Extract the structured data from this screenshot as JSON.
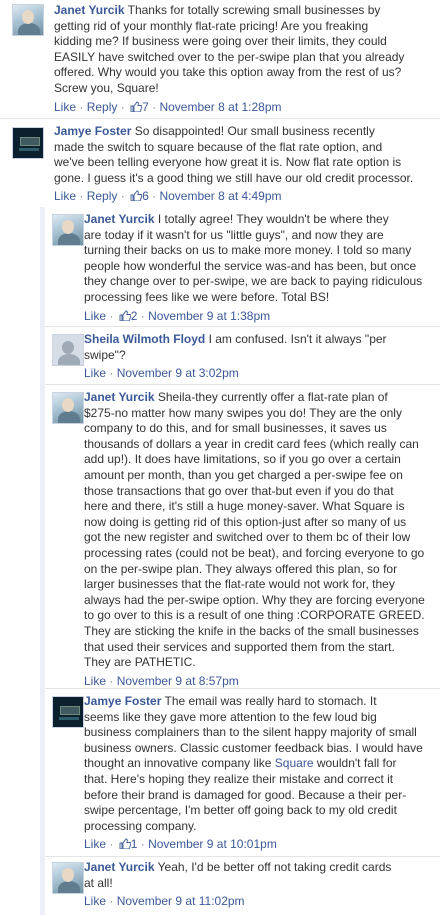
{
  "actions": {
    "like": "Like",
    "reply": "Reply",
    "separator": "·"
  },
  "comments": [
    {
      "author": "Janet Yurcik",
      "text": "Thanks for totally screwing small businesses by\ngetting rid of your monthly flat-rate pricing! Are you freaking\nkidding me? If business were going over their limits, they could\nEASILY have switched over to the per-swipe plan that you already\noffered. Why would you take this option away from the rest of us?\nScrew you, Square!",
      "likes": "7",
      "timestamp": "November 8 at 1:28pm"
    },
    {
      "author": "Jamye Foster",
      "text": "So disappointed! Our small business recently\nmade the switch to square because of the flat rate option, and\nwe've been telling everyone how great it is. Now flat rate option is\ngone. I guess it's a good thing we still have our old credit processor.",
      "likes": "6",
      "timestamp": "November 8 at 4:49pm"
    },
    {
      "author": "Janet Yurcik",
      "text": "I totally agree! They wouldn't be where they\nare today if it wasn't for us \"little guys\", and now they are\nturning their backs on us to make more money. I told so many\npeople how wonderful the service was-and has been, but once\nthey change over to per-swipe, we are back to paying ridiculous\nprocessing fees like we were before. Total BS!",
      "likes": "2",
      "timestamp": "November 9 at 1:38pm"
    },
    {
      "author": "Sheila Wilmoth Floyd",
      "text": "I am confused. Isn't it always \"per\nswipe\"?",
      "timestamp": "November 9 at 3:02pm"
    },
    {
      "author": "Janet Yurcik",
      "text": "Sheila-they currently offer a flat-rate plan of\n$275-no matter how many swipes you do! They are the only\ncompany to do this, and for small businesses, it saves us\nthousands of dollars a year in credit card fees (which really can\nadd up!). It does have limitations, so if you go over a certain\namount per month, than you get charged a per-swipe fee on\nthose transactions that go over that-but even if you do that\nhere and there, it's still a huge money-saver. What Square is\nnow doing is getting rid of this option-just after so many of us\ngot the new register and switched over to them bc of their low\nprocessing rates (could not be beat), and forcing everyone to go\non the per-swipe plan. They always offered this plan, so for\nlarger businesses that the flat-rate would not work for, they\nalways had the per-swipe option. Why they are forcing everyone\nto go over to this is a result of one thing :CORPORATE GREED.\nThey are sticking the knife in the backs of the small businesses\nthat used their services and supported them from the start.\nThey are PATHETIC.",
      "timestamp": "November 9 at 8:57pm"
    },
    {
      "author": "Jamye Foster",
      "text_before": "The email was really hard to stomach. It\nseems like they gave more attention to the few loud big\nbusiness complainers than to the silent happy majority of small\nbusiness owners. Classic customer feedback bias. I would have\nthought an innovative company like ",
      "text_link": "Square",
      "text_after": " wouldn't fall for\nthat. Here's hoping they realize their mistake and correct it\nbefore their brand is damaged for good. Because a their per-\nswipe percentage, I'm better off going back to my old credit\nprocessing company.",
      "likes": "1",
      "timestamp": "November 9 at 10:01pm"
    },
    {
      "author": "Janet Yurcik",
      "text": "Yeah, I'd be better off not taking credit cards\nat all!",
      "timestamp": "November 9 at 11:02pm"
    }
  ]
}
